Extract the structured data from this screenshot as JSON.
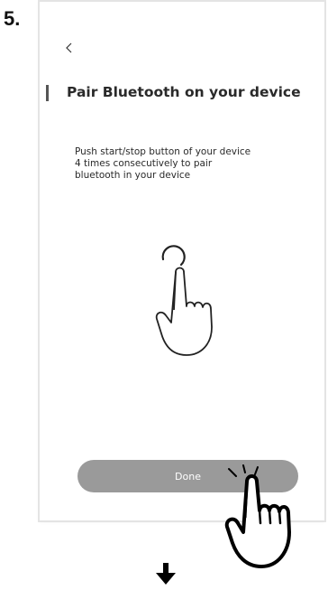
{
  "step": {
    "number": "5."
  },
  "screen": {
    "back_icon": "chevron-left-icon",
    "title": "Pair Bluetooth on your device",
    "instructions": [
      "Push start/stop button of your device",
      "4 times consecutively to pair",
      "bluetooth in your device"
    ],
    "illustration_icon": "hand-pressing-button-icon",
    "done_label": "Done"
  },
  "overlay": {
    "tap_hand_icon": "pointing-hand-icon",
    "next_arrow_icon": "down-arrow-icon"
  },
  "colors": {
    "button": "#9a9a9a",
    "button_text": "#ffffff",
    "text": "#2a2a2a"
  }
}
